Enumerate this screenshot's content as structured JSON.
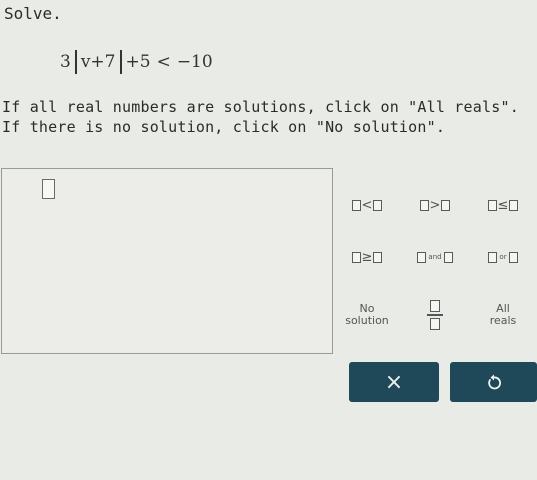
{
  "prompt": "Solve.",
  "equation": {
    "coef": "3",
    "inner": "v+7",
    "plus": "+5",
    "op": "<",
    "rhs": "−10"
  },
  "instructions": {
    "line1": "If all real numbers are solutions, click on \"All reals\".",
    "line2": "If there is no solution, click on \"No solution\"."
  },
  "keypad": {
    "less_than": "<",
    "greater_than": ">",
    "less_equal": "≤",
    "greater_equal": "≥",
    "and": "and",
    "or": "or",
    "no_solution_line1": "No",
    "no_solution_line2": "solution",
    "all_reals_line1": "All",
    "all_reals_line2": "reals"
  },
  "actions": {
    "clear": "×"
  },
  "colors": {
    "button_bg": "#1f4959",
    "page_bg": "#e9ebe6"
  }
}
